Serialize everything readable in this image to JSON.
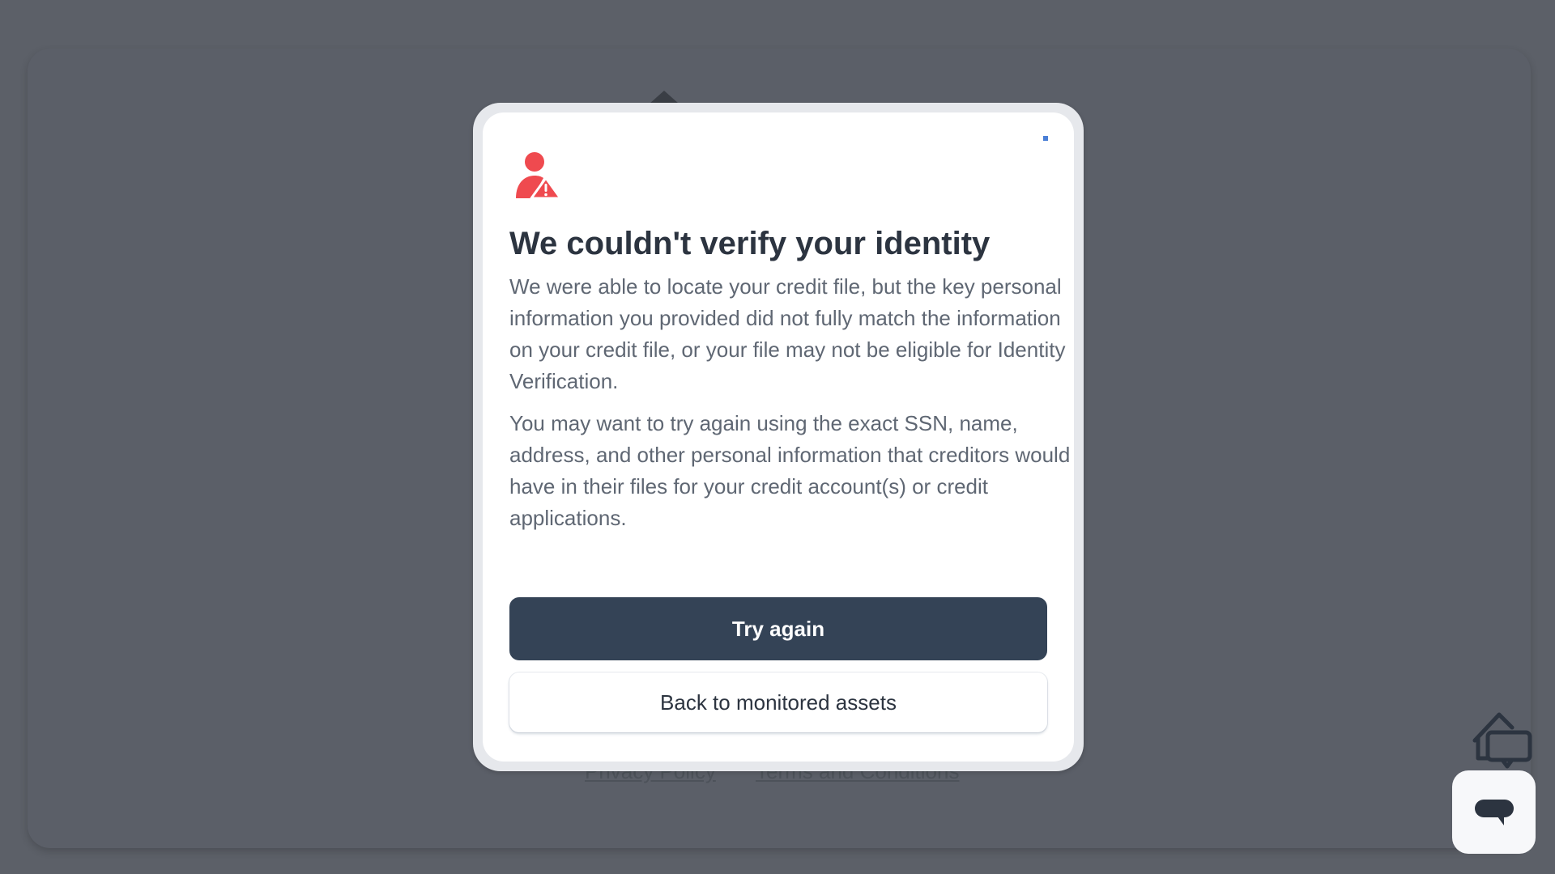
{
  "background": {
    "footer_links": {
      "privacy": "Privacy Policy",
      "terms": "Terms and Conditions"
    }
  },
  "modal": {
    "icon": "user-alert-icon",
    "close_icon": "close-icon",
    "title": "We couldn't verify your identity",
    "paragraph_1": "We were able to locate your credit file, but the key personal information you provided did not fully match the information on your credit file, or your file may not be eligible for Identity Verification.",
    "paragraph_2": "You may want to try again using the exact SSN, name, address, and other personal information that creditors would have in their files for your credit account(s) or credit applications.",
    "primary_button": "Try again",
    "secondary_button": "Back to monitored assets"
  },
  "widgets": {
    "home_icon": "home-chat-icon",
    "chat_icon": "chat-bubble-icon"
  },
  "colors": {
    "overlay": "#5c6068",
    "primary_button": "#344356",
    "alert_red": "#ef4a4f",
    "title": "#2c3440",
    "body_text": "#5f6773"
  }
}
